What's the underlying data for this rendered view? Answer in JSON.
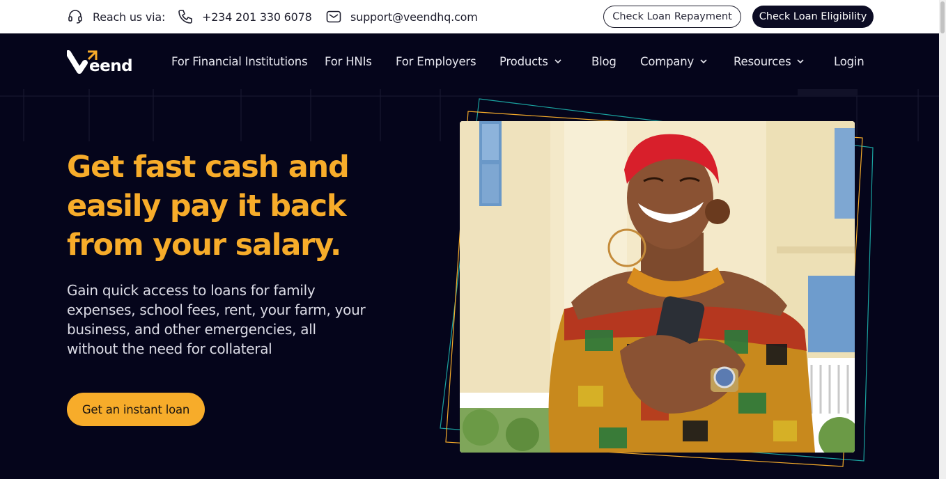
{
  "topbar": {
    "reach_label": "Reach us via:",
    "phone": "+234 201 330 6078",
    "email": "support@veendhq.com",
    "repayment_button": "Check Loan Repayment",
    "eligibility_button": "Check Loan Eligibility"
  },
  "nav": {
    "logo_text": "eend",
    "items": [
      {
        "label": "For Financial Institutions"
      },
      {
        "label": "For HNIs"
      },
      {
        "label": "For Employers"
      },
      {
        "label": "Products"
      },
      {
        "label": "Blog"
      },
      {
        "label": "Company"
      },
      {
        "label": "Resources"
      },
      {
        "label": "Login"
      }
    ]
  },
  "hero": {
    "title_lines": [
      "Get fast cash and",
      "easily pay it back",
      "from your salary."
    ],
    "subtitle_lines": [
      "Gain quick access to loans for family",
      "expenses, school fees, rent, your farm, your",
      "business, and other emergencies, all",
      "without the need for collateral"
    ],
    "cta_label": "Get an instant loan"
  },
  "colors": {
    "background": "#05051b",
    "accent": "#f7ac2a",
    "teal": "#1aa3a0",
    "dark_button": "#0c0c24"
  },
  "icons": [
    "headset-icon",
    "phone-icon",
    "mail-icon",
    "chevron-down-icon"
  ]
}
